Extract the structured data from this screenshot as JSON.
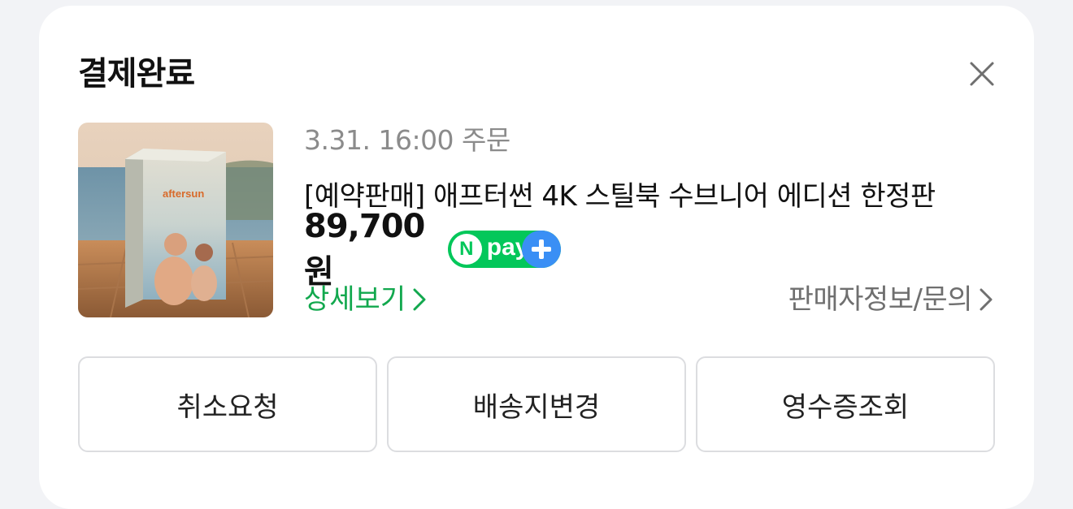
{
  "header": {
    "title": "결제완료",
    "close_icon": "close-icon"
  },
  "order": {
    "date": "3.31. 16:00 주문",
    "product_name": "[예약판매] 애프터썬 4K 스틸북 수브니어 에디션 한정판",
    "price": "89,700원",
    "badge": {
      "n_letter": "N",
      "text": "pay"
    },
    "detail_link": "상세보기",
    "seller_link": "판매자정보/문의",
    "thumbnail_text": "aftersun"
  },
  "actions": {
    "cancel": "취소요청",
    "change_address": "배송지변경",
    "receipt": "영수증조회"
  },
  "colors": {
    "accent_green": "#12a84e",
    "npay_green": "#03c75a",
    "npay_blue": "#3a8ff5"
  }
}
